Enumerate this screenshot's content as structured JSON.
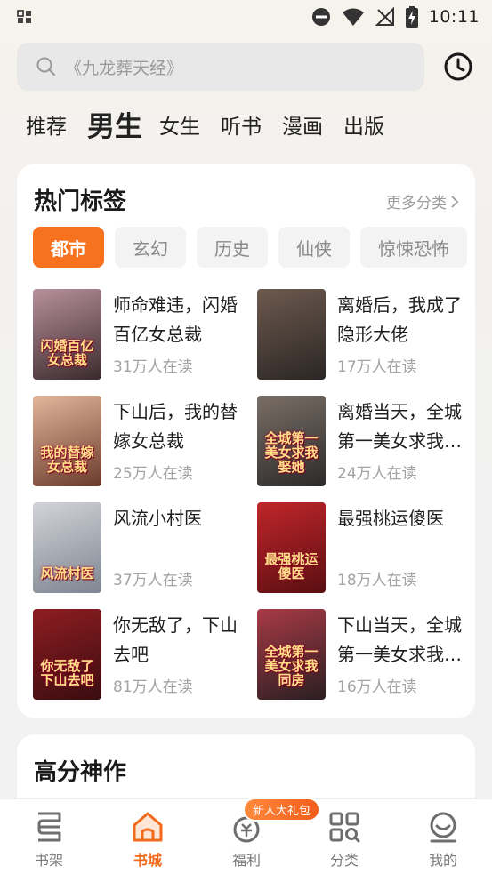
{
  "status_bar": {
    "time": "10:11"
  },
  "search": {
    "placeholder": "《九龙葬天经》"
  },
  "channel_tabs": [
    {
      "label": "推荐",
      "active": false
    },
    {
      "label": "男生",
      "active": true
    },
    {
      "label": "女生",
      "active": false
    },
    {
      "label": "听书",
      "active": false
    },
    {
      "label": "漫画",
      "active": false
    },
    {
      "label": "出版",
      "active": false
    }
  ],
  "hot_tags": {
    "title": "热门标签",
    "more_label": "更多分类",
    "tags": [
      "都市",
      "玄幻",
      "历史",
      "仙侠",
      "惊悚恐怖"
    ],
    "active_tag": "都市",
    "books": [
      {
        "title": "师命难违，闪婚百亿女总裁",
        "readers": "31万人在读",
        "cover_text": "闪婚百亿女总裁",
        "cover_colors": [
          "#3a2a2e",
          "#b8919a"
        ]
      },
      {
        "title": "离婚后，我成了隐形大佬",
        "readers": "17万人在读",
        "cover_text": "",
        "cover_colors": [
          "#2b2624",
          "#6d5a4f"
        ]
      },
      {
        "title": "下山后，我的替嫁女总裁",
        "readers": "25万人在读",
        "cover_text": "我的替嫁女总裁",
        "cover_colors": [
          "#6b3b2c",
          "#e2b79b"
        ]
      },
      {
        "title": "离婚当天，全城第一美女求我娶她",
        "readers": "24万人在读",
        "cover_text": "全城第一美女求我娶她",
        "cover_colors": [
          "#2c2a2a",
          "#7a6f66"
        ]
      },
      {
        "title": "风流小村医",
        "readers": "37万人在读",
        "cover_text": "风流村医",
        "cover_colors": [
          "#7e8591",
          "#d2d4d8"
        ]
      },
      {
        "title": "最强桃运傻医",
        "readers": "18万人在读",
        "cover_text": "最强桃运傻医",
        "cover_colors": [
          "#5a0e12",
          "#c0262a"
        ]
      },
      {
        "title": "你无敌了，下山去吧",
        "readers": "81万人在读",
        "cover_text": "你无敌了下山去吧",
        "cover_colors": [
          "#3a0d10",
          "#8e1d22"
        ]
      },
      {
        "title": "下山当天，全城第一美女求我同房",
        "readers": "16万人在读",
        "cover_text": "全城第一美女求我同房",
        "cover_colors": [
          "#2a1f22",
          "#a83a46"
        ]
      }
    ]
  },
  "high_score": {
    "title": "高分神作"
  },
  "bottom_nav": {
    "items": [
      {
        "label": "书架",
        "icon": "bookshelf-icon",
        "active": false
      },
      {
        "label": "书城",
        "icon": "bookstore-home-icon",
        "active": true
      },
      {
        "label": "福利",
        "icon": "welfare-icon",
        "active": false
      },
      {
        "label": "分类",
        "icon": "category-icon",
        "active": false
      },
      {
        "label": "我的",
        "icon": "profile-icon",
        "active": false
      }
    ],
    "gift_badge": "新人大礼包"
  },
  "colors": {
    "accent": "#f7721f",
    "nav_active": "#f26a1b"
  }
}
